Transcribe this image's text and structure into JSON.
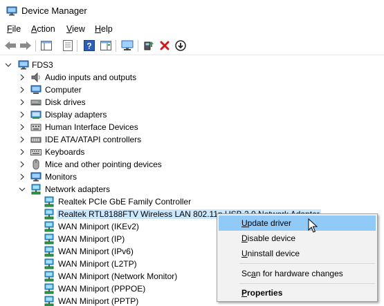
{
  "window": {
    "title": "Device Manager"
  },
  "menu": [
    {
      "label": "File",
      "accel": "F",
      "rest": "ile"
    },
    {
      "label": "Action",
      "accel": "A",
      "rest": "ction"
    },
    {
      "label": "View",
      "accel": "V",
      "rest": "iew"
    },
    {
      "label": "Help",
      "accel": "H",
      "rest": "elp"
    }
  ],
  "toolbar": {
    "buttons": [
      "back-arrow-icon",
      "forward-arrow-icon",
      "properties-sheet-icon",
      "show-hide-tree-icon",
      "help-icon",
      "action-pane-icon",
      "monitor-scan-icon",
      "update-driver-icon",
      "uninstall-x-icon",
      "disable-down-icon"
    ]
  },
  "tree": {
    "root": "FDS3",
    "categories": [
      {
        "label": "Audio inputs and outputs",
        "icon": "speaker-icon"
      },
      {
        "label": "Computer",
        "icon": "computer-icon"
      },
      {
        "label": "Disk drives",
        "icon": "disk-drive-icon"
      },
      {
        "label": "Display adapters",
        "icon": "display-adapter-icon"
      },
      {
        "label": "Human Interface Devices",
        "icon": "hid-icon"
      },
      {
        "label": "IDE ATA/ATAPI controllers",
        "icon": "ide-controller-icon"
      },
      {
        "label": "Keyboards",
        "icon": "keyboard-icon"
      },
      {
        "label": "Mice and other pointing devices",
        "icon": "mouse-icon"
      },
      {
        "label": "Monitors",
        "icon": "monitor-icon"
      },
      {
        "label": "Network adapters",
        "icon": "network-adapter-icon"
      }
    ],
    "network_children": [
      "Realtek PCIe GbE Family Controller",
      "Realtek RTL8188FTV Wireless LAN 802.11n USB 2.0 Network Adapter",
      "WAN Miniport (IKEv2)",
      "WAN Miniport (IP)",
      "WAN Miniport (IPv6)",
      "WAN Miniport (L2TP)",
      "WAN Miniport (Network Monitor)",
      "WAN Miniport (PPPOE)",
      "WAN Miniport (PPTP)"
    ]
  },
  "context_menu": {
    "items": [
      {
        "pre": "",
        "accel": "U",
        "post": "pdate driver"
      },
      {
        "pre": "",
        "accel": "D",
        "post": "isable device"
      },
      {
        "pre": "",
        "accel": "U",
        "post": "ninstall device"
      },
      {
        "pre": "Sc",
        "accel": "a",
        "post": "n for hardware changes"
      },
      {
        "pre": "",
        "accel": "P",
        "post": "roperties"
      }
    ]
  },
  "colors": {
    "highlight": "#91c9f7",
    "selection": "#cce8ff",
    "accent": "#0078d7"
  }
}
